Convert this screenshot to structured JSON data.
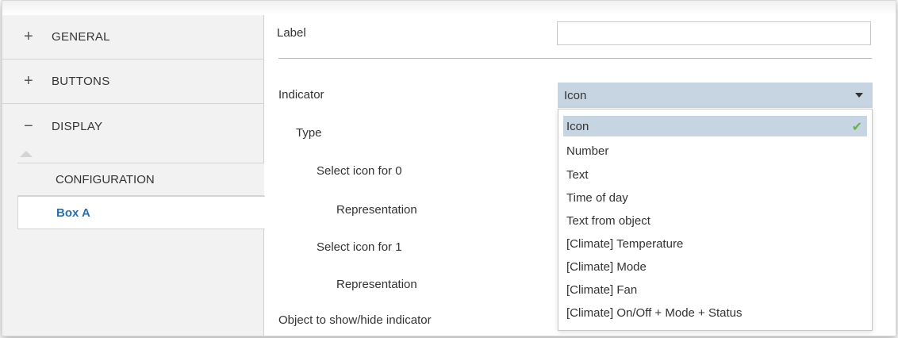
{
  "sidebar": {
    "items": [
      {
        "sign": "+",
        "label": "GENERAL"
      },
      {
        "sign": "+",
        "label": "BUTTONS"
      },
      {
        "sign": "−",
        "label": "DISPLAY"
      }
    ],
    "subitems": [
      {
        "label": "CONFIGURATION"
      },
      {
        "label": "Box A"
      }
    ]
  },
  "main": {
    "label_field": {
      "label": "Label",
      "value": ""
    },
    "indicator": {
      "label": "Indicator",
      "selected": "Icon"
    },
    "params": [
      {
        "label": "Type"
      },
      {
        "label": "Select icon for 0"
      },
      {
        "label": "Representation"
      },
      {
        "label": "Select icon for 1"
      },
      {
        "label": "Representation"
      },
      {
        "label": "Object to show/hide indicator"
      }
    ],
    "dropdown_options": [
      "Icon",
      "Number",
      "Text",
      "Time of day",
      "Text from object",
      "[Climate] Temperature",
      "[Climate] Mode",
      "[Climate] Fan",
      "[Climate] On/Off + Mode + Status"
    ],
    "check_glyph": "✔"
  },
  "colors": {
    "selected_bg": "#c7d4e1",
    "active_link": "#2b6fae",
    "check": "#6ab04c",
    "sidebar_bg": "#f2f2f2"
  }
}
